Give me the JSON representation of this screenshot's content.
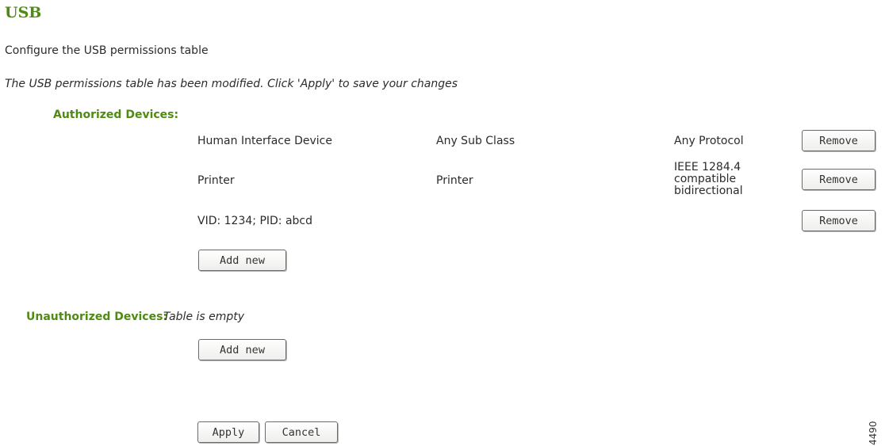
{
  "page": {
    "title": "USB",
    "description": "Configure the USB permissions table",
    "notice": "The USB permissions table has been modified. Click 'Apply' to save your changes"
  },
  "authorized": {
    "label": "Authorized Devices:",
    "rows": [
      {
        "device": "Human Interface Device",
        "subclass": "Any Sub Class",
        "protocol": "Any Protocol",
        "remove_label": "Remove"
      },
      {
        "device": "Printer",
        "subclass": "Printer",
        "protocol": "IEEE 1284.4 compatible bidirectional",
        "remove_label": "Remove"
      },
      {
        "device": "VID: 1234; PID: abcd",
        "subclass": "",
        "protocol": "",
        "remove_label": "Remove"
      }
    ],
    "add_label": "Add new"
  },
  "unauthorized": {
    "label": "Unauthorized Devices:",
    "empty_text": "Table is empty",
    "add_label": "Add new"
  },
  "actions": {
    "apply_label": "Apply",
    "cancel_label": "Cancel"
  },
  "figure_id": "4490"
}
